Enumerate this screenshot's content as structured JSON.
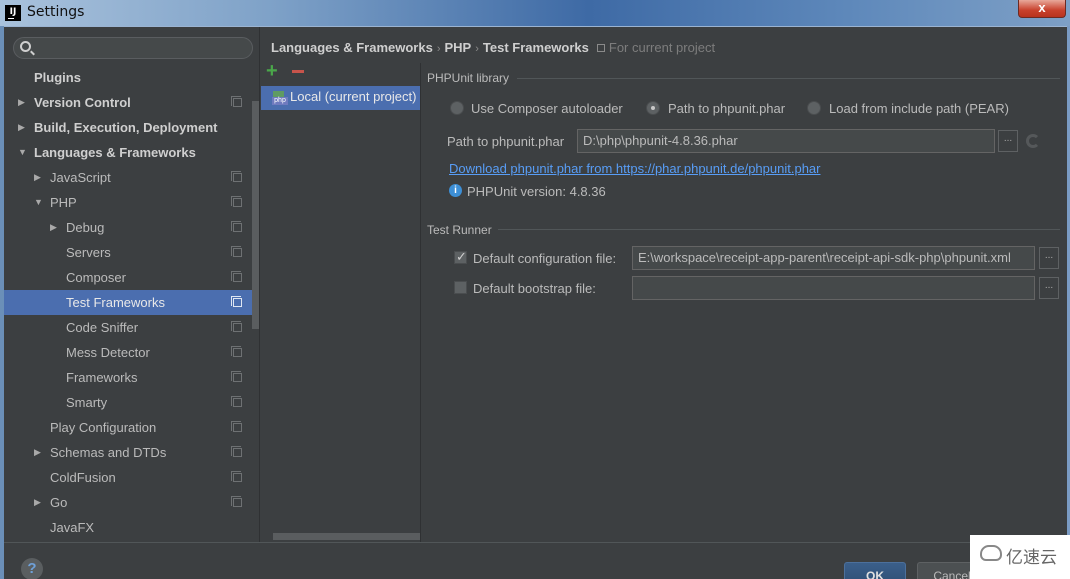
{
  "window": {
    "title": "Settings",
    "app_icon": "IJ",
    "close_label": "x"
  },
  "sidebar": {
    "search": {
      "value": "",
      "placeholder": ""
    },
    "items": [
      {
        "label": "Plugins",
        "level": 0,
        "bold": true,
        "arrow": "",
        "project_scope": false
      },
      {
        "label": "Version Control",
        "level": 0,
        "bold": true,
        "arrow": "▶",
        "project_scope": true
      },
      {
        "label": "Build, Execution, Deployment",
        "level": 0,
        "bold": true,
        "arrow": "▶",
        "project_scope": false
      },
      {
        "label": "Languages & Frameworks",
        "level": 0,
        "bold": true,
        "arrow": "▼",
        "project_scope": false
      },
      {
        "label": "JavaScript",
        "level": 1,
        "bold": false,
        "arrow": "▶",
        "project_scope": true
      },
      {
        "label": "PHP",
        "level": 1,
        "bold": false,
        "arrow": "▼",
        "project_scope": true
      },
      {
        "label": "Debug",
        "level": 2,
        "bold": false,
        "arrow": "▶",
        "project_scope": true
      },
      {
        "label": "Servers",
        "level": 2,
        "bold": false,
        "arrow": "",
        "project_scope": true
      },
      {
        "label": "Composer",
        "level": 2,
        "bold": false,
        "arrow": "",
        "project_scope": true
      },
      {
        "label": "Test Frameworks",
        "level": 2,
        "bold": false,
        "arrow": "",
        "project_scope": true,
        "selected": true
      },
      {
        "label": "Code Sniffer",
        "level": 2,
        "bold": false,
        "arrow": "",
        "project_scope": true
      },
      {
        "label": "Mess Detector",
        "level": 2,
        "bold": false,
        "arrow": "",
        "project_scope": true
      },
      {
        "label": "Frameworks",
        "level": 2,
        "bold": false,
        "arrow": "",
        "project_scope": true
      },
      {
        "label": "Smarty",
        "level": 2,
        "bold": false,
        "arrow": "",
        "project_scope": true
      },
      {
        "label": "Play Configuration",
        "level": 1,
        "bold": false,
        "arrow": "",
        "project_scope": true
      },
      {
        "label": "Schemas and DTDs",
        "level": 1,
        "bold": false,
        "arrow": "▶",
        "project_scope": true
      },
      {
        "label": "ColdFusion",
        "level": 1,
        "bold": false,
        "arrow": "",
        "project_scope": true
      },
      {
        "label": "Go",
        "level": 1,
        "bold": false,
        "arrow": "▶",
        "project_scope": true
      },
      {
        "label": "JavaFX",
        "level": 1,
        "bold": false,
        "arrow": "",
        "project_scope": false
      }
    ]
  },
  "breadcrumb": {
    "parts": [
      "Languages & Frameworks",
      "PHP",
      "Test Frameworks"
    ],
    "separator": "›",
    "scope": "For current project"
  },
  "config_list": {
    "add_label": "+",
    "items": [
      {
        "label": "Local (current project)",
        "icon": "php",
        "selected": true
      }
    ]
  },
  "phpunit": {
    "section_title": "PHPUnit library",
    "radios": [
      {
        "label": "Use Composer autoloader",
        "checked": false
      },
      {
        "label": "Path to phpunit.phar",
        "checked": true
      },
      {
        "label": "Load from include path (PEAR)",
        "checked": false
      }
    ],
    "path_label": "Path to phpunit.phar",
    "path_value": "D:\\php\\phpunit-4.8.36.phar",
    "browse_label": "...",
    "download_link": "Download phpunit.phar from https://phar.phpunit.de/phpunit.phar",
    "version_text": "PHPUnit version: 4.8.36"
  },
  "test_runner": {
    "section_title": "Test Runner",
    "config_file": {
      "label": "Default configuration file:",
      "checked": true,
      "value": "E:\\workspace\\receipt-app-parent\\receipt-api-sdk-php\\phpunit.xml"
    },
    "bootstrap_file": {
      "label": "Default bootstrap file:",
      "checked": false,
      "value": ""
    },
    "browse_label": "..."
  },
  "footer": {
    "help_label": "?",
    "ok_label": "OK",
    "cancel_label": "Cancel"
  },
  "watermark": {
    "text": "亿速云"
  }
}
